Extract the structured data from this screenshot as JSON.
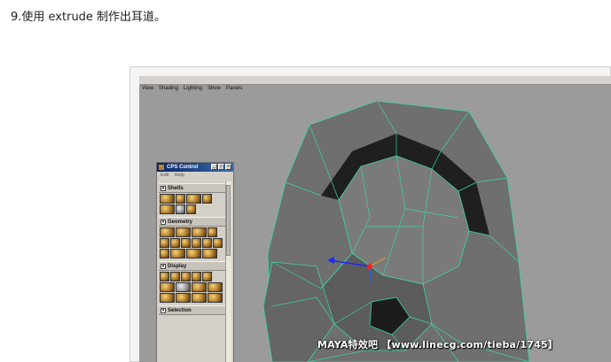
{
  "caption": "9.使用 extrude 制作出耳道。",
  "viewport": {
    "menu": [
      "View",
      "Shading",
      "Lighting",
      "Show",
      "Panels"
    ]
  },
  "cps_panel": {
    "title": "CPS Control",
    "menu": [
      "Edit",
      "Help"
    ],
    "sections": [
      {
        "label": "Shells"
      },
      {
        "label": "Geometry"
      },
      {
        "label": "Display"
      },
      {
        "label": "Selection"
      }
    ]
  },
  "watermark": "MAYA特效吧 【www.linecg.com/tieba/1745】",
  "colors": {
    "viewport_bg": "#9b9b9b",
    "mesh_face": "#6e6e6e",
    "wire": "#3cd4a6"
  }
}
